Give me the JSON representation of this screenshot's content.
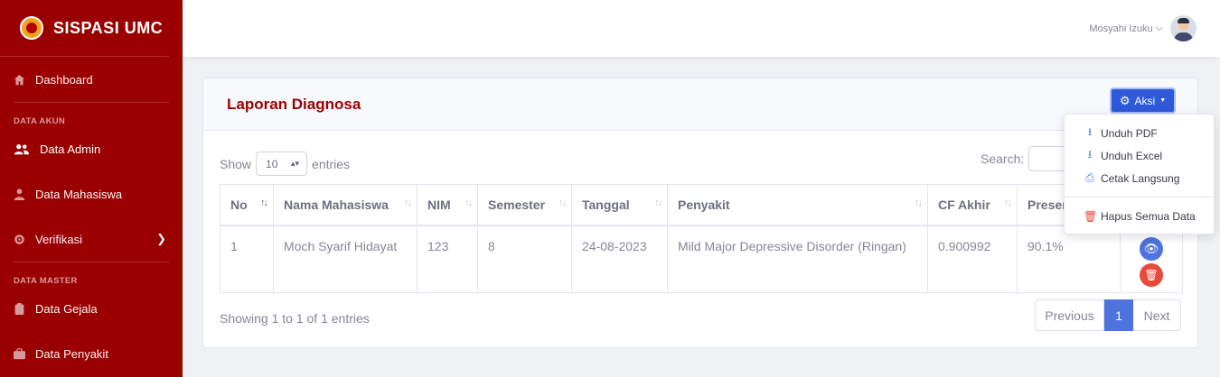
{
  "brand": {
    "name": "SISPASI UMC"
  },
  "sidebar": {
    "dashboard": "Dashboard",
    "heading_akun": "DATA AKUN",
    "data_admin": "Data Admin",
    "data_mahasiswa": "Data Mahasiswa",
    "verifikasi": "Verifikasi",
    "heading_master": "DATA MASTER",
    "data_gejala": "Data Gejala",
    "data_penyakit": "Data Penyakit"
  },
  "topbar": {
    "user_name": "Mosyahi Izuku"
  },
  "card": {
    "title": "Laporan Diagnosa",
    "aksi_label": "Aksi"
  },
  "dropdown": {
    "unduh_pdf": "Unduh PDF",
    "unduh_excel": "Unduh Excel",
    "cetak": "Cetak Langsung",
    "hapus_semua": "Hapus Semua Data"
  },
  "table_controls": {
    "show_label": "Show",
    "entries_value": "10",
    "entries_label": "entries",
    "search_label": "Search:"
  },
  "table": {
    "headers": [
      "No",
      "Nama Mahasiswa",
      "NIM",
      "Semester",
      "Tanggal",
      "Penyakit",
      "CF Akhir",
      "Presentase"
    ],
    "rows": [
      [
        "1",
        "Moch Syarif Hidayat",
        "123",
        "8",
        "24-08-2023",
        "Mild Major Depressive Disorder (Ringan)",
        "0.900992",
        "90.1%"
      ]
    ]
  },
  "footer": {
    "info": "Showing 1 to 1 of 1 entries",
    "previous": "Previous",
    "page": "1",
    "next": "Next"
  },
  "colors": {
    "sidebar": "#9b0000",
    "primary": "#4e73df",
    "danger": "#e74a3b"
  }
}
